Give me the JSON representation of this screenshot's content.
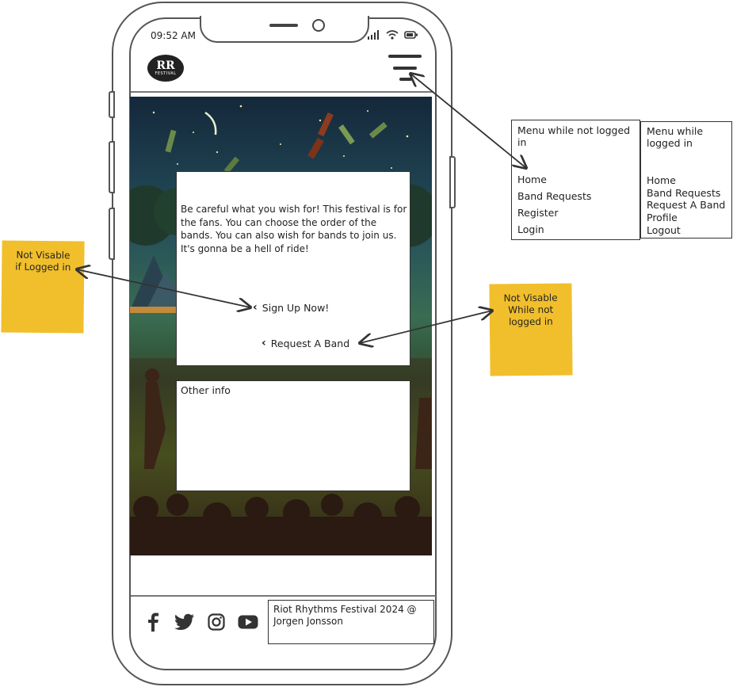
{
  "status_bar": {
    "time": "09:52 AM"
  },
  "logo": {
    "initials": "RR",
    "subtitle": "FESTIVAL"
  },
  "intro": {
    "text": "Be careful what you wish for! This festival is for the fans. You can choose the order of the bands. You can also wish for bands to join us. It's gonna be a hell of ride!",
    "signup_label": "Sign Up Now!",
    "request_label": "Request A Band"
  },
  "other": {
    "title": "Other info"
  },
  "footer": {
    "copyright": "Riot Rhythms Festival 2024 @ Jorgen Jonsson",
    "social": [
      "facebook-icon",
      "twitter-icon",
      "instagram-icon",
      "youtube-icon"
    ]
  },
  "menu_logged_out": {
    "title": "Menu while not logged in",
    "items": [
      "Home",
      "Band Requests",
      "Register",
      "Login"
    ]
  },
  "menu_logged_in": {
    "title_line1": "Menu while",
    "title_line2": "logged in",
    "items": [
      "Home",
      "Band Requests",
      "Request A Band",
      "Profile",
      "Logout"
    ]
  },
  "notes": {
    "left_line1": "Not Visable",
    "left_line2": "if Logged in",
    "right_line1": "Not Visable",
    "right_line2": "While  not",
    "right_line3": "logged in"
  },
  "colors": {
    "sticky": "#f1bf2c",
    "outline": "#555555",
    "text": "#222222"
  }
}
